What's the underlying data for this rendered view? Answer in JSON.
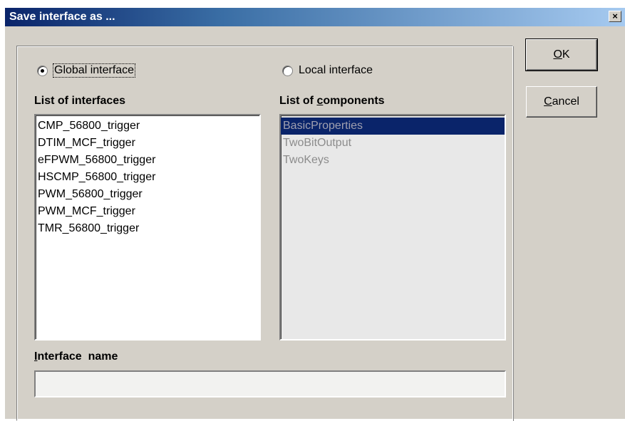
{
  "window": {
    "title": "Save interface as ...",
    "close_glyph": "×"
  },
  "radios": {
    "global_label": "Global interface",
    "global_checked": true,
    "local_label": "Local interface",
    "local_checked": false
  },
  "interfaces": {
    "label_prefix": "List of interfaces",
    "items": [
      "CMP_56800_trigger",
      "DTIM_MCF_trigger",
      "eFPWM_56800_trigger",
      "HSCMP_56800_trigger",
      "PWM_56800_trigger",
      "PWM_MCF_trigger",
      "TMR_56800_trigger"
    ]
  },
  "components": {
    "label_prefix": "List of ",
    "label_accel": "c",
    "label_rest": "omponents",
    "items": [
      "BasicProperties",
      "TwoBitOutput",
      "TwoKeys"
    ],
    "selected_index": 0
  },
  "name_field": {
    "label_accel": "I",
    "label_rest": "nterface  name",
    "value": ""
  },
  "buttons": {
    "ok_accel": "O",
    "ok_rest": "K",
    "cancel_accel": "C",
    "cancel_rest": "ancel"
  }
}
